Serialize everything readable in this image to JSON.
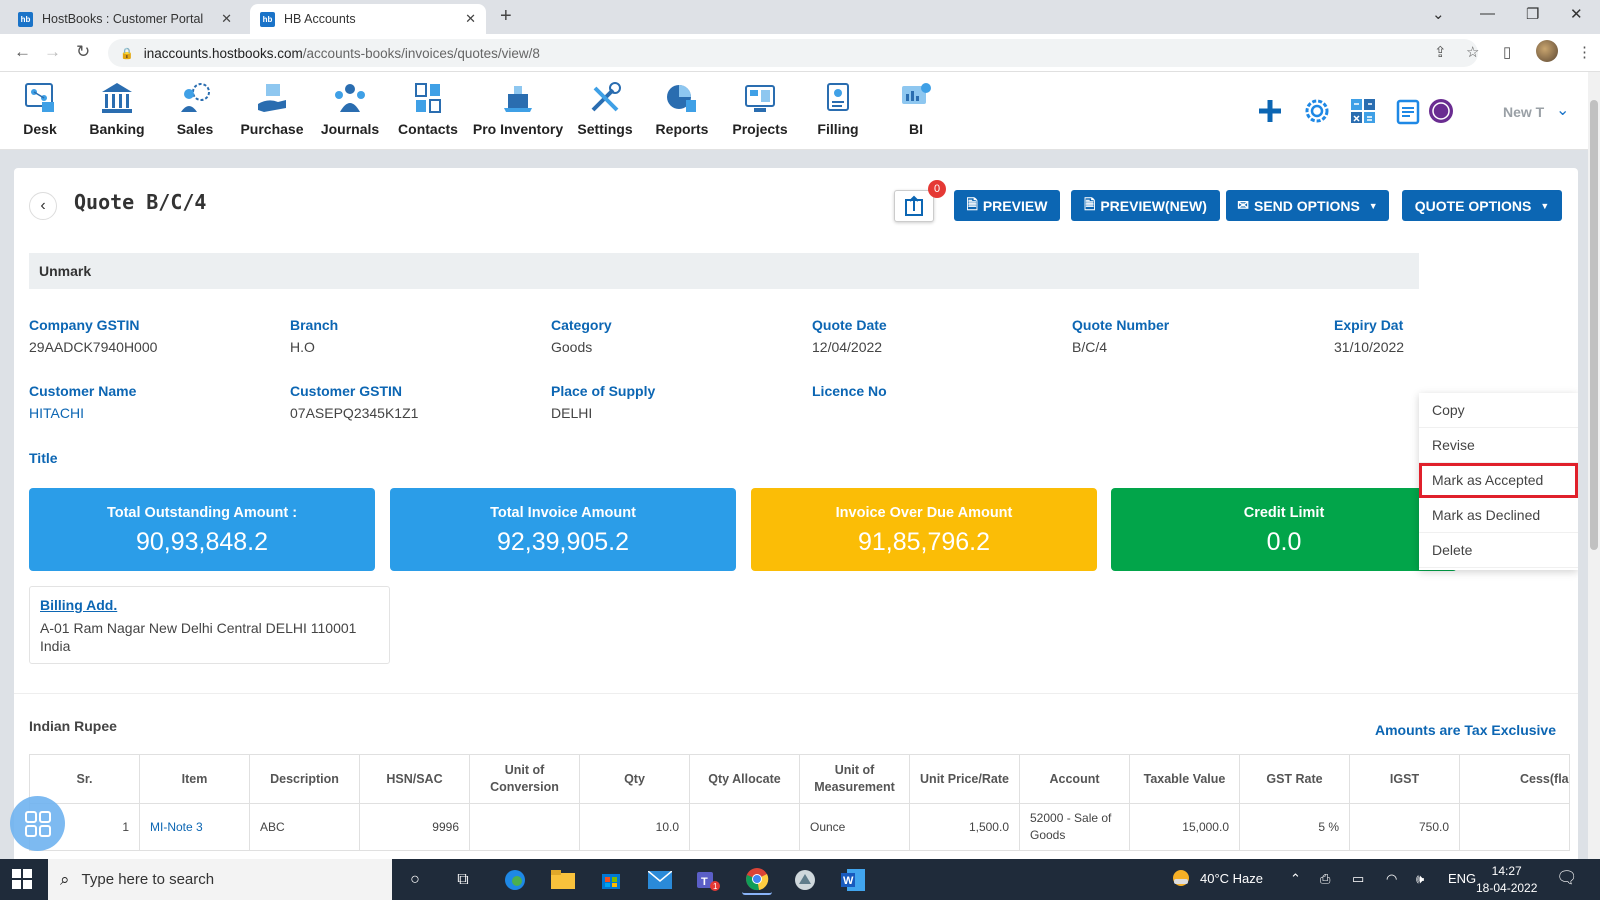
{
  "browser": {
    "tabs": [
      {
        "label": "HostBooks : Customer Portal",
        "favicon": "hb",
        "active": false
      },
      {
        "label": "HB Accounts",
        "favicon": "hb",
        "active": true
      }
    ],
    "url_host": "inaccounts.hostbooks.com",
    "url_path": "/accounts-books/invoices/quotes/view/8"
  },
  "nav": {
    "items": [
      {
        "label": "Desk",
        "icon": "desk-icon"
      },
      {
        "label": "Banking",
        "icon": "bank-icon"
      },
      {
        "label": "Sales",
        "icon": "sales-icon"
      },
      {
        "label": "Purchase",
        "icon": "purchase-icon"
      },
      {
        "label": "Journals",
        "icon": "journals-icon"
      },
      {
        "label": "Contacts",
        "icon": "contacts-icon"
      },
      {
        "label": "Pro Inventory",
        "icon": "inventory-icon"
      },
      {
        "label": "Settings",
        "icon": "settings-tools-icon"
      },
      {
        "label": "Reports",
        "icon": "reports-icon"
      },
      {
        "label": "Projects",
        "icon": "projects-icon"
      },
      {
        "label": "Filling",
        "icon": "filling-icon"
      },
      {
        "label": "BI",
        "icon": "bi-icon"
      }
    ],
    "new_label": "New T"
  },
  "quote": {
    "title": "Quote B/C/4",
    "notification_count": "0",
    "buttons": {
      "preview": "PREVIEW",
      "preview_new": "PREVIEW(NEW)",
      "send_options": "SEND OPTIONS",
      "quote_options": "QUOTE OPTIONS"
    },
    "status_bar": "Unmark",
    "fields": {
      "company_gstin_label": "Company GSTIN",
      "company_gstin": "29AADCK7940H000",
      "branch_label": "Branch",
      "branch": "H.O",
      "category_label": "Category",
      "category": "Goods",
      "quote_date_label": "Quote Date",
      "quote_date": "12/04/2022",
      "quote_number_label": "Quote Number",
      "quote_number": "B/C/4",
      "expiry_date_label": "Expiry Dat",
      "expiry_date": "31/10/2022",
      "customer_name_label": "Customer Name",
      "customer_name": "HITACHI",
      "customer_gstin_label": "Customer GSTIN",
      "customer_gstin": "07ASEPQ2345K1Z1",
      "place_of_supply_label": "Place of Supply",
      "place_of_supply": "DELHI",
      "licence_no_label": "Licence No",
      "title_label": "Title"
    },
    "stats": [
      {
        "label": "Total Outstanding Amount :",
        "value": "90,93,848.2",
        "color": "#2b9de8"
      },
      {
        "label": "Total Invoice Amount",
        "value": "92,39,905.2",
        "color": "#2b9de8"
      },
      {
        "label": "Invoice Over Due Amount",
        "value": "91,85,796.2",
        "color": "#fbbd06"
      },
      {
        "label": "Credit Limit",
        "value": "0.0",
        "color": "#02a54a"
      }
    ],
    "billing": {
      "title": "Billing Add.",
      "line1": "A-01 Ram Nagar New Delhi Central DELHI 110001",
      "line2": "India"
    },
    "currency": "Indian Rupee",
    "tax_note": "Amounts are Tax Exclusive"
  },
  "table": {
    "headers": [
      "Sr.",
      "Item",
      "Description",
      "HSN/SAC",
      "Unit of Conversion",
      "Qty",
      "Qty Allocate",
      "Unit of Measurement",
      "Unit Price/Rate",
      "Account",
      "Taxable Value",
      "GST Rate",
      "IGST",
      "Cess(fla"
    ],
    "rows": [
      {
        "sr": "1",
        "item": "MI-Note 3",
        "description": "ABC",
        "hsn": "9996",
        "uoc": "",
        "qty": "10.0",
        "qty_allocate": "",
        "uom": "Ounce",
        "rate": "1,500.0",
        "account": "52000 - Sale of Goods",
        "taxable": "15,000.0",
        "gst_rate": "5 %",
        "igst": "750.0",
        "cess": ""
      }
    ]
  },
  "dropdown": {
    "items": [
      "Copy",
      "Revise",
      "Mark as Accepted",
      "Mark as Declined",
      "Delete"
    ],
    "highlighted": "Mark as Accepted",
    "highlight_color": "#e0202b"
  },
  "taskbar": {
    "search_placeholder": "Type here to search",
    "weather": "40°C  Haze",
    "language": "ENG",
    "time": "14:27",
    "date": "18-04-2022",
    "teams_badge": "1"
  }
}
